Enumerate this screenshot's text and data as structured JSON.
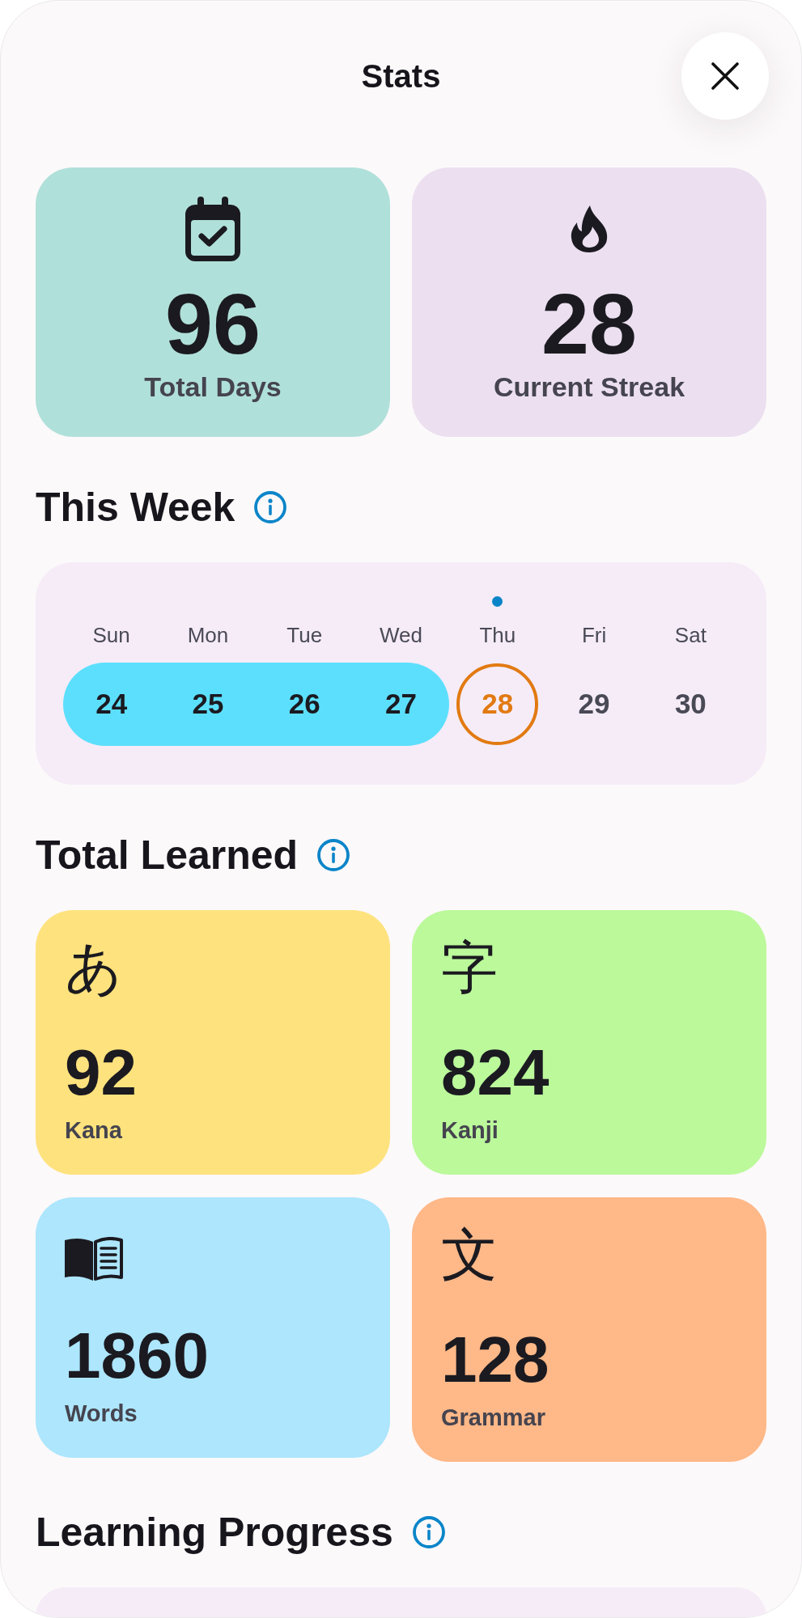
{
  "header": {
    "title": "Stats"
  },
  "summary": [
    {
      "kind": "total",
      "value": "96",
      "label": "Total Days",
      "color": "#b0e0da"
    },
    {
      "kind": "streak",
      "value": "28",
      "label": "Current Streak",
      "color": "#ebdff0"
    }
  ],
  "this_week": {
    "title": "This Week",
    "days": [
      {
        "day": "Sun",
        "date": "24",
        "studied": true,
        "today": false
      },
      {
        "day": "Mon",
        "date": "25",
        "studied": true,
        "today": false
      },
      {
        "day": "Tue",
        "date": "26",
        "studied": true,
        "today": false
      },
      {
        "day": "Wed",
        "date": "27",
        "studied": true,
        "today": false
      },
      {
        "day": "Thu",
        "date": "28",
        "studied": false,
        "today": true
      },
      {
        "day": "Fri",
        "date": "29",
        "studied": false,
        "today": false
      },
      {
        "day": "Sat",
        "date": "30",
        "studied": false,
        "today": false
      }
    ]
  },
  "total_learned": {
    "title": "Total Learned",
    "items": [
      {
        "kind": "glyph",
        "glyph": "あ",
        "value": "92",
        "label": "Kana",
        "color": "#fee27e"
      },
      {
        "kind": "icon",
        "value": "1860",
        "label": "Words",
        "color": "#ade6fd"
      },
      {
        "kind": "glyph",
        "glyph": "字",
        "value": "824",
        "label": "Kanji",
        "color": "#bbf99b"
      },
      {
        "kind": "glyph",
        "glyph": "文",
        "value": "128",
        "label": "Grammar",
        "color": "#ffb888"
      }
    ]
  },
  "learning_progress": {
    "title": "Learning Progress"
  }
}
